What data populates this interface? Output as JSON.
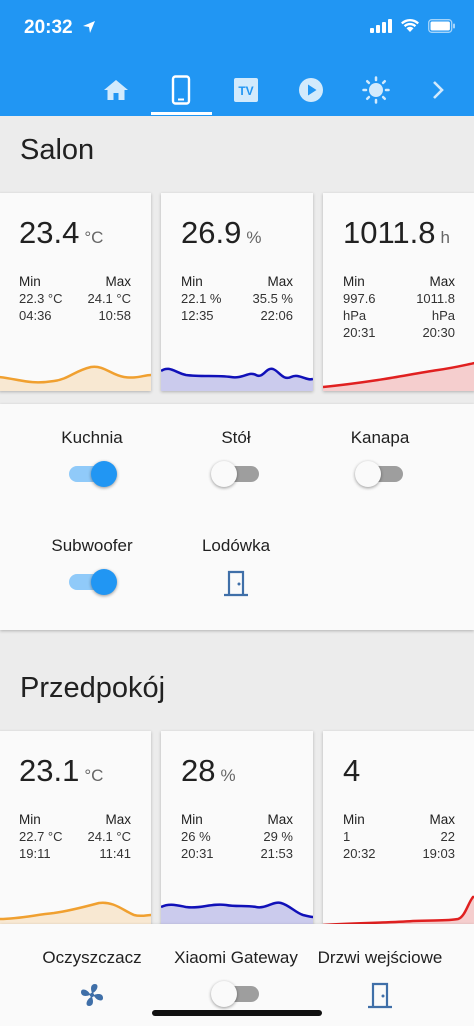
{
  "status_bar": {
    "time": "20:32"
  },
  "tabs": [
    {
      "icon": "home-icon"
    },
    {
      "icon": "phone-icon",
      "active": true
    },
    {
      "icon": "tv-icon",
      "label": "TV"
    },
    {
      "icon": "play-icon"
    },
    {
      "icon": "sun-icon"
    },
    {
      "icon": "chevron-right-icon"
    }
  ],
  "colors": {
    "accent": "#2196f3",
    "temp": "#f0a030",
    "humidity": "#1010b8",
    "pressure": "#e02020"
  },
  "salon": {
    "title": "Salon",
    "sensors": [
      {
        "value": "23.4",
        "unit": "°C",
        "min_label": "Min",
        "max_label": "Max",
        "min_value": "22.3 °C",
        "max_value": "24.1 °C",
        "min_time": "04:36",
        "max_time": "10:58"
      },
      {
        "value": "26.9",
        "unit": "%",
        "min_label": "Min",
        "max_label": "Max",
        "min_value": "22.1 %",
        "max_value": "35.5 %",
        "min_time": "12:35",
        "max_time": "22:06"
      },
      {
        "value": "1011.8",
        "unit": "h",
        "min_label": "Min",
        "max_label": "Max",
        "min_value": "997.6",
        "max_value": "1011.8",
        "min_unit": "hPa",
        "max_unit": "hPa",
        "min_time": "20:31",
        "max_time": "20:30"
      }
    ],
    "switches": [
      {
        "label": "Kuchnia",
        "state": "on"
      },
      {
        "label": "Stół",
        "state": "off"
      },
      {
        "label": "Kanapa",
        "state": "off"
      },
      {
        "label": "Subwoofer",
        "state": "on"
      },
      {
        "label": "Lodówka",
        "icon": "door-icon"
      }
    ]
  },
  "przedpokoj": {
    "title": "Przedpokój",
    "sensors": [
      {
        "value": "23.1",
        "unit": "°C",
        "min_label": "Min",
        "max_label": "Max",
        "min_value": "22.7 °C",
        "max_value": "24.1 °C",
        "min_time": "19:11",
        "max_time": "11:41"
      },
      {
        "value": "28",
        "unit": "%",
        "min_label": "Min",
        "max_label": "Max",
        "min_value": "26 %",
        "max_value": "29 %",
        "min_time": "20:31",
        "max_time": "21:53"
      },
      {
        "value": "4",
        "unit": "",
        "min_label": "Min",
        "max_label": "Max",
        "min_value": "1",
        "max_value": "22",
        "min_time": "20:32",
        "max_time": "19:03"
      }
    ],
    "entities": [
      {
        "label": "Oczyszczacz",
        "icon": "fan-icon"
      },
      {
        "label": "Xiaomi Gateway",
        "state": "off"
      },
      {
        "label": "Drzwi wejściowe",
        "icon": "door-icon"
      }
    ]
  }
}
